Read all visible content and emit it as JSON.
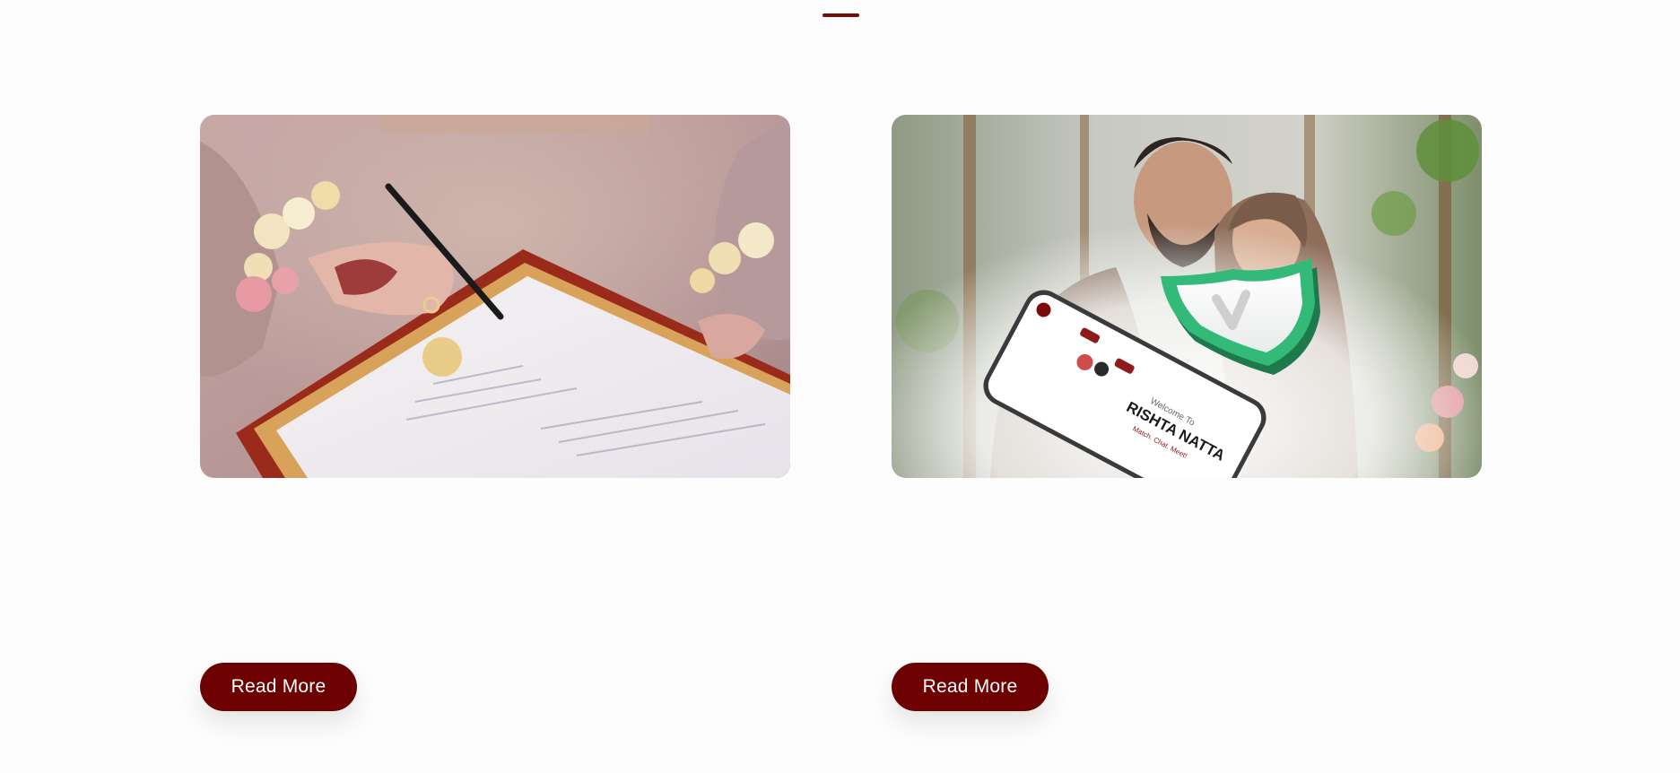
{
  "colors": {
    "accent": "#7a0a0a",
    "button": "#6d0000",
    "button_text": "#ffffff",
    "background": "#fefdfd"
  },
  "cards": [
    {
      "image": "wedding-contract-signing-photo",
      "button_label": "Read More"
    },
    {
      "image": "couple-with-secure-app-photo",
      "app_screen": {
        "welcome": "Welcome To",
        "brand": "RISHTA NATTA",
        "tagline": "Match. Chat. Meet!"
      },
      "shield": "check-shield-icon",
      "button_label": "Read More"
    }
  ]
}
